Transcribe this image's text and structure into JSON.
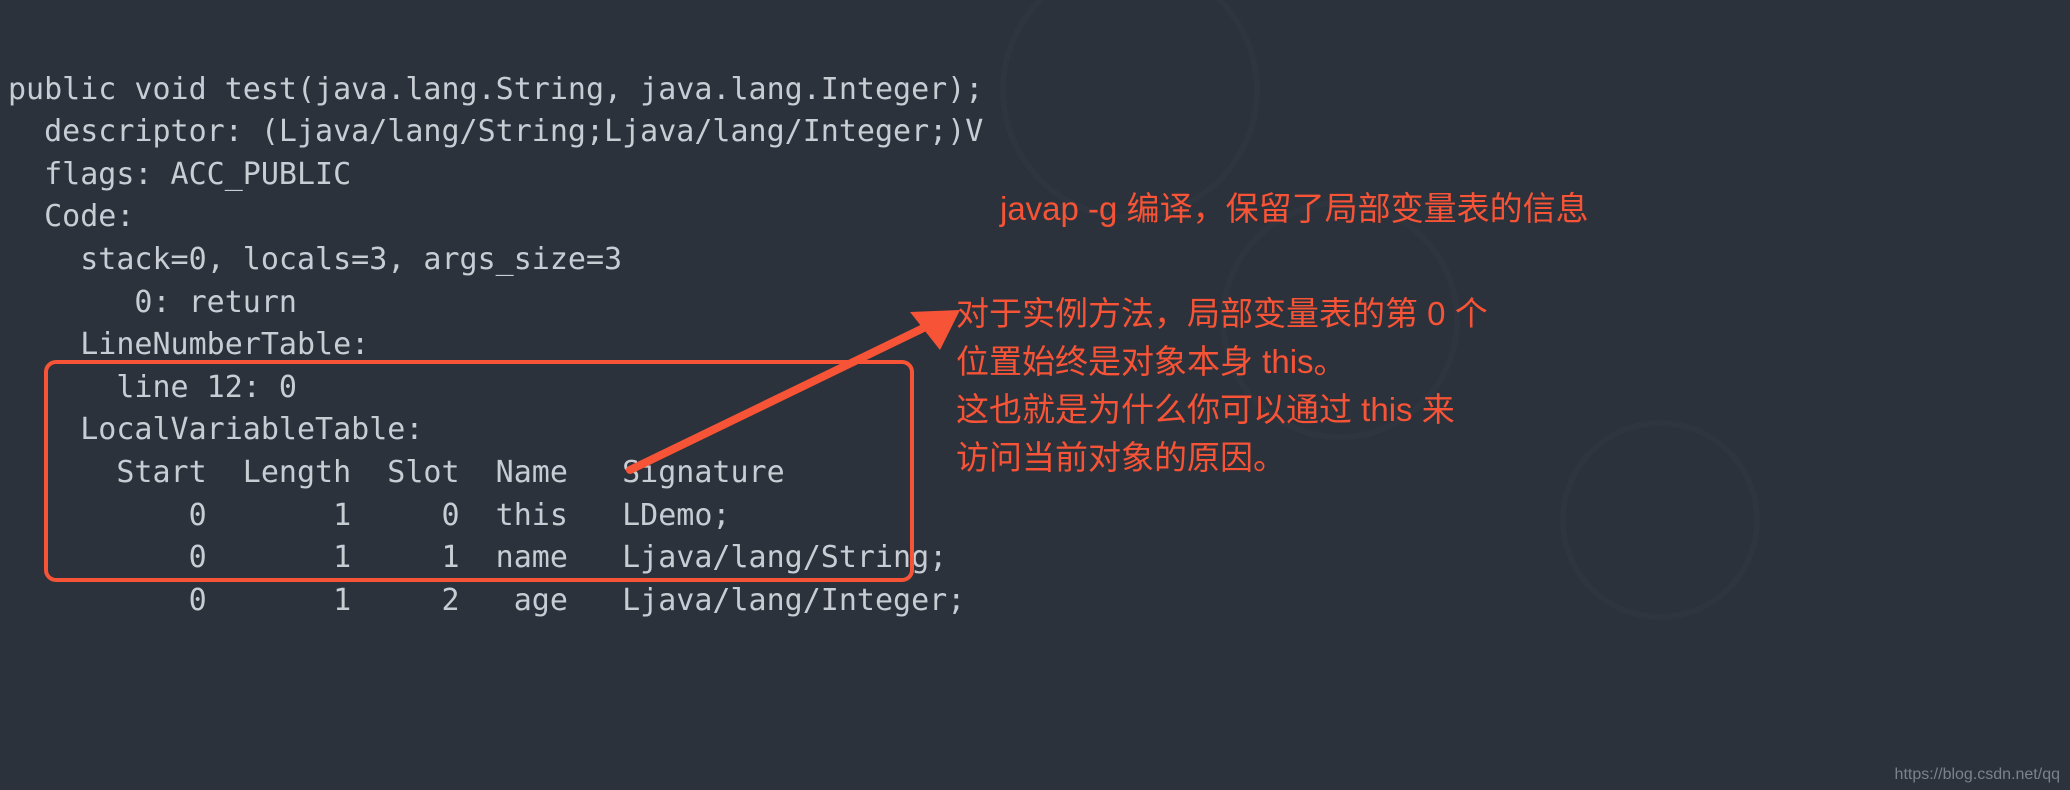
{
  "code": {
    "line1": "public void test(java.lang.String, java.lang.Integer);",
    "line2": "  descriptor: (Ljava/lang/String;Ljava/lang/Integer;)V",
    "line3": "  flags: ACC_PUBLIC",
    "line4": "  Code:",
    "line5": "    stack=0, locals=3, args_size=3",
    "line6": "       0: return",
    "line7": "    LineNumberTable:",
    "line8": "      line 12: 0",
    "line9": "    LocalVariableTable:",
    "line10": "      Start  Length  Slot  Name   Signature",
    "line11": "          0       1     0  this   LDemo;",
    "line12": "          0       1     1  name   Ljava/lang/String;",
    "line13": "          0       1     2   age   Ljava/lang/Integer;"
  },
  "annotations": {
    "a1": "javap -g 编译，保留了局部变量表的信息",
    "a2_l1": "对于实例方法，局部变量表的第 0 个",
    "a2_l2": "位置始终是对象本身 this。",
    "a2_l3": "这也就是为什么你可以通过 this 来",
    "a2_l4": "访问当前对象的原因。"
  },
  "footer": "https://blog.csdn.net/qq"
}
